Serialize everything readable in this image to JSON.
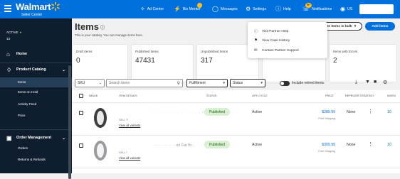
{
  "header": {
    "brand_name": "Walmart",
    "brand_sub": "Seller Center",
    "nav": [
      {
        "label": "Ad Center",
        "icon": "ad-center-icon"
      },
      {
        "label": "Biz Mentor",
        "icon": "biz-mentor-icon"
      },
      {
        "label": "Messages",
        "icon": "messages-icon"
      },
      {
        "label": "Settings",
        "icon": "settings-icon"
      },
      {
        "label": "Help",
        "icon": "help-icon"
      },
      {
        "label": "Notifications",
        "icon": "notifications-icon"
      },
      {
        "label": "US",
        "icon": "flag-icon"
      }
    ],
    "notifications_badge": "99+",
    "brand_color": "#0071dc",
    "spark_color": "#ffc220"
  },
  "sidebar": {
    "active_label": "ACTIVE",
    "active_id": "13",
    "items": [
      {
        "label": "Home",
        "icon": "home-icon"
      },
      {
        "label": "Product Catalog",
        "icon": "tag-icon"
      }
    ],
    "catalog_subitems": [
      "Items",
      "Items on Hold",
      "Activity Feed",
      "Price"
    ],
    "order_section": "Order Management",
    "order_subitems": [
      "Orders",
      "Returns & Refunds"
    ]
  },
  "page": {
    "title": "Items",
    "description": "This is your catalog. You can manage items here.",
    "update_button": "Update items in bulk",
    "add_button": "Add items"
  },
  "cards": [
    {
      "label": "Draft Items",
      "value": "0"
    },
    {
      "label": "Published Items",
      "value": "47431"
    },
    {
      "label": "Unpublished Items",
      "value": "317"
    },
    {
      "label": "Items with Errors",
      "value": "2"
    }
  ],
  "help_menu": {
    "items": [
      {
        "label": "Visit Partner Help",
        "icon": "help-circle-icon"
      },
      {
        "label": "View Case History",
        "icon": "flag-outline-icon"
      },
      {
        "label": "Contact Partner Support",
        "icon": "mail-icon"
      }
    ]
  },
  "toolbar": {
    "search_type": "SKU",
    "search_placeholder": "Search items",
    "fulfillment": "Fulfillment",
    "status": "Status",
    "include_retired": "Include retired items"
  },
  "table": {
    "columns": [
      "IMAGE",
      "ITEM DETAILS",
      "STATUS",
      "LIFE CYCLE",
      "PRICE",
      "REPRICER STRATEGY",
      "INVEN"
    ],
    "rows": [
      {
        "title": "· · · · · · · · · · · · ... ill ...",
        "sku": "SKU: 7l",
        "variants": "View all variants",
        "status": "Published",
        "lifecycle": "Active",
        "price": "$289.99",
        "shipping": "Free Shipping",
        "repricer": "None",
        "inventory": "10"
      },
      {
        "title": "· · · · · · · · · · ad Flat Br...",
        "sku": "SKU: 7",
        "variants": "View all variants",
        "status": "Published",
        "lifecycle": "Active",
        "price": "$309.99",
        "shipping": "Free Shipping",
        "repricer": "None",
        "inventory": "10"
      }
    ]
  }
}
